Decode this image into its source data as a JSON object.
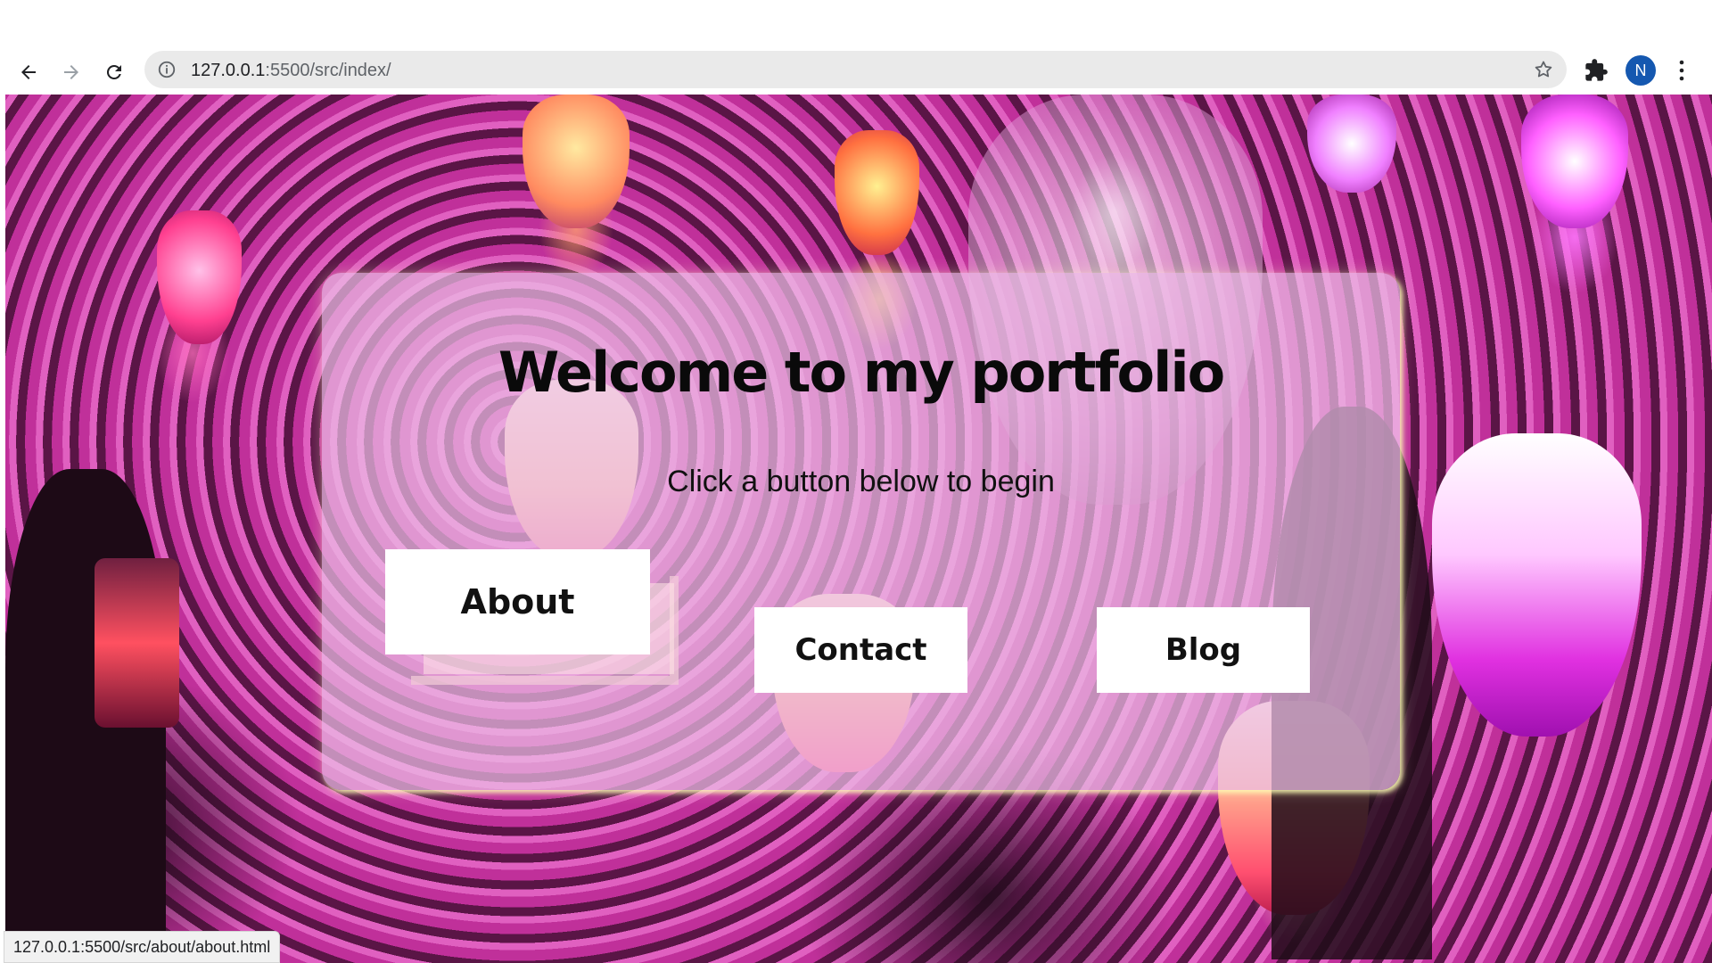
{
  "browser": {
    "url_host": "127.0.0.1",
    "url_rest": ":5500/src/index/",
    "profile_initial": "N",
    "status_url": "127.0.0.1:5500/src/about/about.html"
  },
  "page": {
    "title": "Welcome to my portfolio",
    "subtitle": "Click a button below to begin",
    "buttons": {
      "about": "About",
      "contact": "Contact",
      "blog": "Blog"
    }
  },
  "colors": {
    "card_bg": "#ebbee6",
    "avatar": "#1558b0",
    "omnibox": "#eaeaea"
  }
}
